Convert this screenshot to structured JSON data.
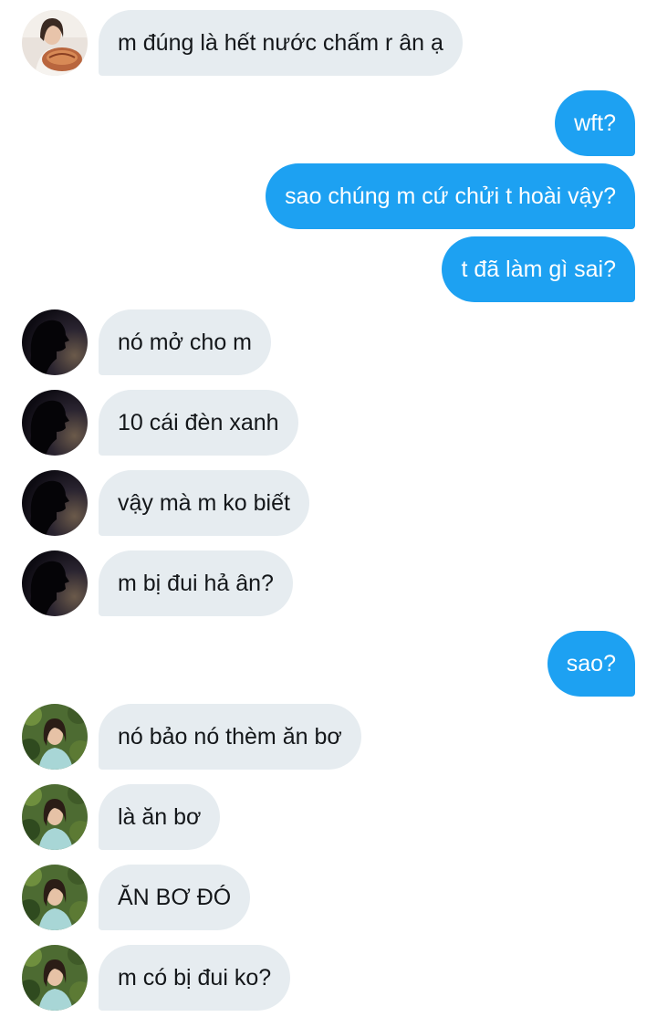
{
  "conversation": {
    "messages": [
      {
        "side": "incoming",
        "text": "m đúng là hết nước chấm r ân ạ",
        "avatar": "avatar-food-girl"
      },
      {
        "side": "outgoing",
        "text": "wft?"
      },
      {
        "side": "outgoing",
        "text": "sao chúng m cứ chửi t hoài vậy?"
      },
      {
        "side": "outgoing",
        "text": "t đã làm gì sai?"
      },
      {
        "side": "incoming",
        "text": "nó mở cho m",
        "avatar": "avatar-silhouette"
      },
      {
        "side": "incoming",
        "text": "10 cái đèn xanh",
        "avatar": "avatar-silhouette"
      },
      {
        "side": "incoming",
        "text": "vậy mà m ko biết",
        "avatar": "avatar-silhouette"
      },
      {
        "side": "incoming",
        "text": "m bị đui hả ân?",
        "avatar": "avatar-silhouette"
      },
      {
        "side": "outgoing",
        "text": "sao?"
      },
      {
        "side": "incoming",
        "text": "nó bảo nó thèm ăn bơ",
        "avatar": "avatar-garden-girl"
      },
      {
        "side": "incoming",
        "text": "là ăn bơ",
        "avatar": "avatar-garden-girl"
      },
      {
        "side": "incoming",
        "text": "ĂN BƠ ĐÓ",
        "avatar": "avatar-garden-girl"
      },
      {
        "side": "incoming",
        "text": "m có bị đui ko?",
        "avatar": "avatar-garden-girl"
      }
    ]
  },
  "colors": {
    "incoming_bubble": "#e6ecf0",
    "outgoing_bubble": "#1da1f2",
    "incoming_text": "#14171a",
    "outgoing_text": "#ffffff"
  }
}
